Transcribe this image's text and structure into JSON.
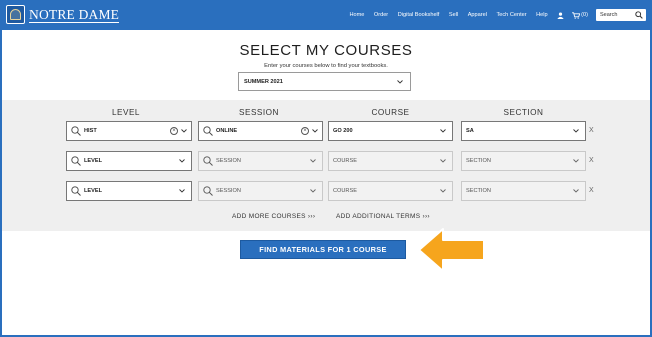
{
  "header": {
    "logo_text": "NOTRE DAME",
    "logo_icon": "dome-seal-icon",
    "nav": [
      "Home",
      "Order",
      "Digital Bookshelf",
      "Sell",
      "Apparel",
      "Tech Center",
      "Help"
    ],
    "account_icon": "user-icon",
    "cart_icon": "cart-icon",
    "cart_count": "(0)",
    "search_placeholder": "Search",
    "color": "#2a6fbe"
  },
  "main": {
    "title": "SELECT MY COURSES",
    "subtitle": "Enter your courses below to find your textbooks.",
    "term": "SUMMER 2021"
  },
  "courses": {
    "columns": [
      "LEVEL",
      "SESSION",
      "COURSE",
      "SECTION"
    ],
    "rows": [
      {
        "level": "HIST",
        "session": "ONLINE",
        "course": "GO 200",
        "section": "SA",
        "remove": "X"
      },
      {
        "level": "LEVEL",
        "session": "SESSION",
        "course": "COURSE",
        "section": "SECTION",
        "remove": "X"
      },
      {
        "level": "LEVEL",
        "session": "SESSION",
        "course": "COURSE",
        "section": "SECTION",
        "remove": "X"
      }
    ],
    "add_more": "ADD MORE COURSES ›››",
    "add_terms": "ADD ADDITIONAL TERMS ›››"
  },
  "action": {
    "find_label": "FIND MATERIALS FOR 1 COURSE",
    "arrow_color": "#f6a51d"
  }
}
